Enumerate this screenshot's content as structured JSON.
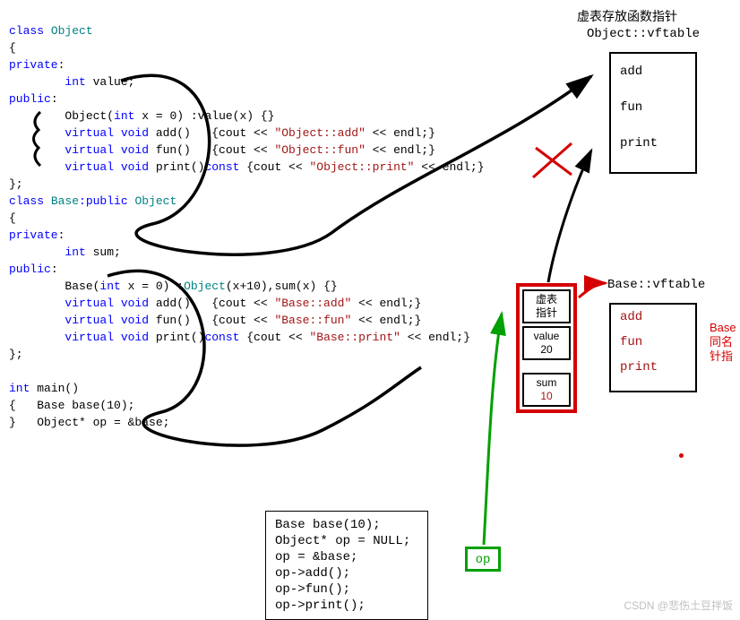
{
  "code": {
    "line01_a": "class ",
    "line01_b": "Object",
    "line02": "{",
    "line03": "private",
    "line03b": ":",
    "line04": "        int ",
    "line04b": "value;",
    "line05": "public",
    "line05b": ":",
    "line06a": "        Object(",
    "line06b": "int ",
    "line06c": "x = 0) :value(x) {}",
    "line07a": "        virtual void ",
    "line07b": "add()   {cout << ",
    "line07c": "\"Object::add\"",
    "line07d": " << endl;}",
    "line08a": "        virtual void ",
    "line08b": "fun()   {cout << ",
    "line08c": "\"Object::fun\"",
    "line08d": " << endl;}",
    "line09a": "        virtual void ",
    "line09b": "print()",
    "line09c": "const ",
    "line09d": "{cout << ",
    "line09e": "\"Object::print\"",
    "line09f": " << endl;}",
    "line10": "};",
    "line11a": "class ",
    "line11b": "Base",
    "line11c": ":public ",
    "line11d": "Object",
    "line12": "{",
    "line13": "private",
    "line13b": ":",
    "line14": "        int ",
    "line14b": "sum;",
    "line15": "public",
    "line15b": ":",
    "line16a": "        Base(",
    "line16b": "int ",
    "line16c": "x = 0) :",
    "line16d": "Object",
    "line16e": "(x+10),sum(x) {}",
    "line17a": "        virtual void ",
    "line17b": "add()   {cout << ",
    "line17c": "\"Base::add\"",
    "line17d": " << endl;}",
    "line18a": "        virtual void ",
    "line18b": "fun()   {cout << ",
    "line18c": "\"Base::fun\"",
    "line18d": " << endl;}",
    "line19a": "        virtual void ",
    "line19b": "print()",
    "line19c": "const ",
    "line19d": "{cout << ",
    "line19e": "\"Base::print\"",
    "line19f": " << endl;}",
    "line20": "};",
    "line21": "",
    "line22": "int ",
    "line22b": "main()",
    "line23": "{   Base base(10);",
    "line24": "}   Object* op = &base;"
  },
  "snippet": {
    "l1": "Base base(10);",
    "l2": "Object* op = NULL;",
    "l3": "op = &base;",
    "l4": "op->add();",
    "l5": "op->fun();",
    "l6": "op->print();"
  },
  "titles": {
    "t1": "虚表存放函数指针",
    "t2": "Object::vftable",
    "t3": "Base::vftable"
  },
  "vtable_obj": {
    "r1": "add",
    "r2": "fun",
    "r3": "print"
  },
  "vtable_base": {
    "r1": "add",
    "r2": "fun",
    "r3": "print"
  },
  "mem": {
    "vptr_l1": "虚表",
    "vptr_l2": "指针",
    "value_label": "value",
    "value_num": "20",
    "sum_label": "sum",
    "sum_num": "10"
  },
  "op_label": "op",
  "side_red": {
    "l1": "Base",
    "l2": "同名",
    "l3": "针指"
  },
  "watermark": "CSDN @悲伤土豆拌饭"
}
